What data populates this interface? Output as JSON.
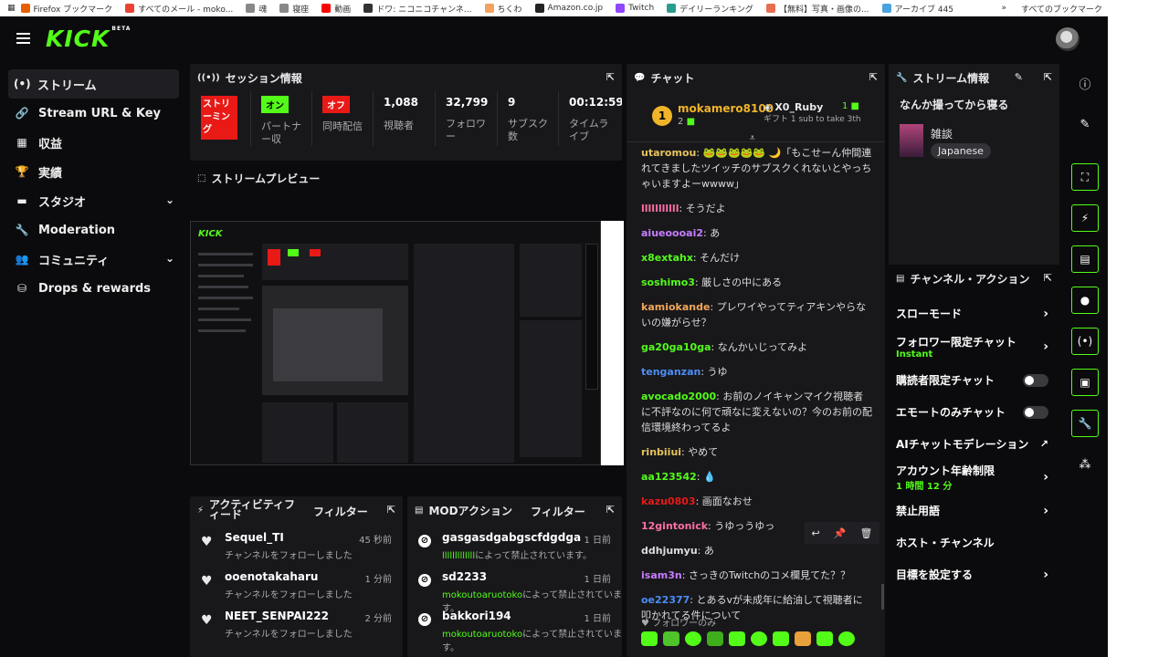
{
  "bookmarks": {
    "items": [
      {
        "label": "Firefox ブックマーク",
        "color": "#e66000"
      },
      {
        "label": "すべてのメール - moko...",
        "color": "#ea4335"
      },
      {
        "label": "魂",
        "color": "#888888"
      },
      {
        "label": "寝座",
        "color": "#888888"
      },
      {
        "label": "動画",
        "color": "#ff0000"
      },
      {
        "label": "ドワ: ニコニコチャンネ...",
        "color": "#333333"
      },
      {
        "label": "ちくわ",
        "color": "#f4a261"
      },
      {
        "label": "Amazon.co.jp",
        "color": "#222222"
      },
      {
        "label": "Twitch",
        "color": "#9146ff"
      },
      {
        "label": "デイリーランキング",
        "color": "#2a9d8f"
      },
      {
        "label": "【無料】写真・画像の...",
        "color": "#e76f51"
      },
      {
        "label": "アーカイブ 445",
        "color": "#4aa3df"
      }
    ],
    "overflow": "»",
    "all_bookmarks": "すべてのブックマーク"
  },
  "logo": {
    "text": "KICK",
    "beta": "BETA"
  },
  "sidebar": {
    "items": [
      {
        "label": "ストリーム",
        "icon": "(•)"
      },
      {
        "label": "Stream URL & Key",
        "icon": "🔗"
      },
      {
        "label": "収益",
        "icon": "▦"
      },
      {
        "label": "実績",
        "icon": "🏆"
      },
      {
        "label": "スタジオ",
        "icon": "▬",
        "chevron": "⌄"
      },
      {
        "label": "Moderation",
        "icon": "🔧"
      },
      {
        "label": "コミュニティ",
        "icon": "👥",
        "chevron": "⌄"
      },
      {
        "label": "Drops & rewards",
        "icon": "⛁"
      }
    ]
  },
  "session": {
    "title": "セッション情報",
    "streaming_badge": "ストリーミング",
    "partner_badge": "オン",
    "partner_label": "パートナー収",
    "simulcast_badge": "オフ",
    "simulcast_label": "同時配信",
    "viewers_value": "1,088",
    "viewers_label": "視聴者",
    "followers_value": "32,799",
    "followers_label": "フォロワー",
    "subs_value": "9",
    "subs_label": "サブスク数",
    "time_value": "00:12:59",
    "time_label": "タイムライブ"
  },
  "preview": {
    "title": "ストリームプレビュー"
  },
  "chat": {
    "title": "チャット",
    "pinned_user": "mokamero8100",
    "pinned_count": "2",
    "gifter": "X0_Ruby",
    "gift_count": "1",
    "gift_text": "ギフト 1 sub to take 3th",
    "messages": [
      {
        "user": "utaromou",
        "color": "#e7c35b",
        "text": "🐸🐸🐸🐸🐸 🌙「もこせーん仲間連れてきましたツイッチのサブスクくれないとやっちゃいますよーwwww」"
      },
      {
        "user": "lllllllllll",
        "color": "#ff6fa5",
        "text": "そうだよ"
      },
      {
        "user": "aiueoooai2",
        "color": "#c77dff",
        "text": "あ"
      },
      {
        "user": "x8extahx",
        "color": "#53fc18",
        "text": "そんだけ"
      },
      {
        "user": "soshimo3",
        "color": "#53fc18",
        "text": "厳しさの中にある"
      },
      {
        "user": "kamiokande",
        "color": "#f2a65a",
        "text": "プレワイやってティアキンやらないの嫌がらせ？"
      },
      {
        "user": "ga20ga10ga",
        "color": "#53fc18",
        "text": "なんかいじってみよ"
      },
      {
        "user": "tenganzan",
        "color": "#4d8df5",
        "text": "うゆ"
      },
      {
        "user": "avocado2000",
        "color": "#53fc18",
        "text": "お前のノイキャンマイク視聴者に不評なのに何で頑なに変えないの？今のお前の配信環境終わってるよ"
      },
      {
        "user": "rinbiiui",
        "color": "#e7c35b",
        "text": "やめて"
      },
      {
        "user": "aa123542",
        "color": "#53fc18",
        "text": "💧"
      },
      {
        "user": "kazu0803",
        "color": "#e91916",
        "text": "画面なおせ"
      },
      {
        "user": "12gintonick",
        "color": "#ff6fa5",
        "text": "うゆっうゆっ"
      },
      {
        "user": "ddhjumyu",
        "color": "#dddddd",
        "text": "あ"
      },
      {
        "user": "isam3n",
        "color": "#c77dff",
        "text": "さっきのTwitchのコメ欄見てた？？"
      },
      {
        "user": "oe22377",
        "color": "#4d8df5",
        "text": "とあるvが未成年に給油して視聴者に叩かれてる件について"
      }
    ],
    "footer_label": "フォロワーのみ"
  },
  "stream_info": {
    "title": "ストリーム情報",
    "stream_title": "なんか撮ってから寝る",
    "category": "雑談",
    "language_tag": "Japanese"
  },
  "channel_actions": {
    "title": "チャンネル・アクション",
    "items": [
      {
        "label": "スローモード",
        "sub": "",
        "control": "arrow"
      },
      {
        "label": "フォロワー限定チャット",
        "sub": "Instant",
        "control": "arrow"
      },
      {
        "label": "購読者限定チャット",
        "sub": "",
        "control": "toggle"
      },
      {
        "label": "エモートのみチャット",
        "sub": "",
        "control": "toggle"
      },
      {
        "label": "AIチャットモデレーション",
        "sub": "",
        "control": "external"
      },
      {
        "label": "アカウント年齢制限",
        "sub": "1 時間 12 分",
        "control": "arrow"
      },
      {
        "label": "禁止用語",
        "sub": "",
        "control": "arrow"
      },
      {
        "label": "ホスト・チャンネル",
        "sub": "",
        "control": "none"
      },
      {
        "label": "目標を設定する",
        "sub": "",
        "control": "arrow"
      }
    ]
  },
  "activity": {
    "title": "アクティビティフィード",
    "filter": "フィルター",
    "items": [
      {
        "name": "Sequel_TI",
        "sub": "チャンネルをフォローしました",
        "time": "45 秒前"
      },
      {
        "name": "ooenotakaharu",
        "sub": "チャンネルをフォローしました",
        "time": "1 分前"
      },
      {
        "name": "NEET_SENPAI222",
        "sub": "チャンネルをフォローしました",
        "time": "2 分前"
      }
    ]
  },
  "mod_actions": {
    "title": "MODアクション",
    "filter": "フィルター",
    "items": [
      {
        "name": "gasgasdgabgscfdgdga",
        "by": "lllllllllllll",
        "sub": "によって禁止されています。",
        "time": "1 日前"
      },
      {
        "name": "sd2233",
        "by": "mokoutoaruotoko",
        "sub": "によって禁止されています。",
        "time": "1 日前"
      },
      {
        "name": "bakkori194",
        "by": "mokoutoaruotoko",
        "sub": "によって禁止されています。",
        "time": "1 日前"
      }
    ]
  },
  "colors": {
    "accent": "#53fc18",
    "danger": "#e91916",
    "panel": "#18181b",
    "background": "#0b0b0d"
  }
}
